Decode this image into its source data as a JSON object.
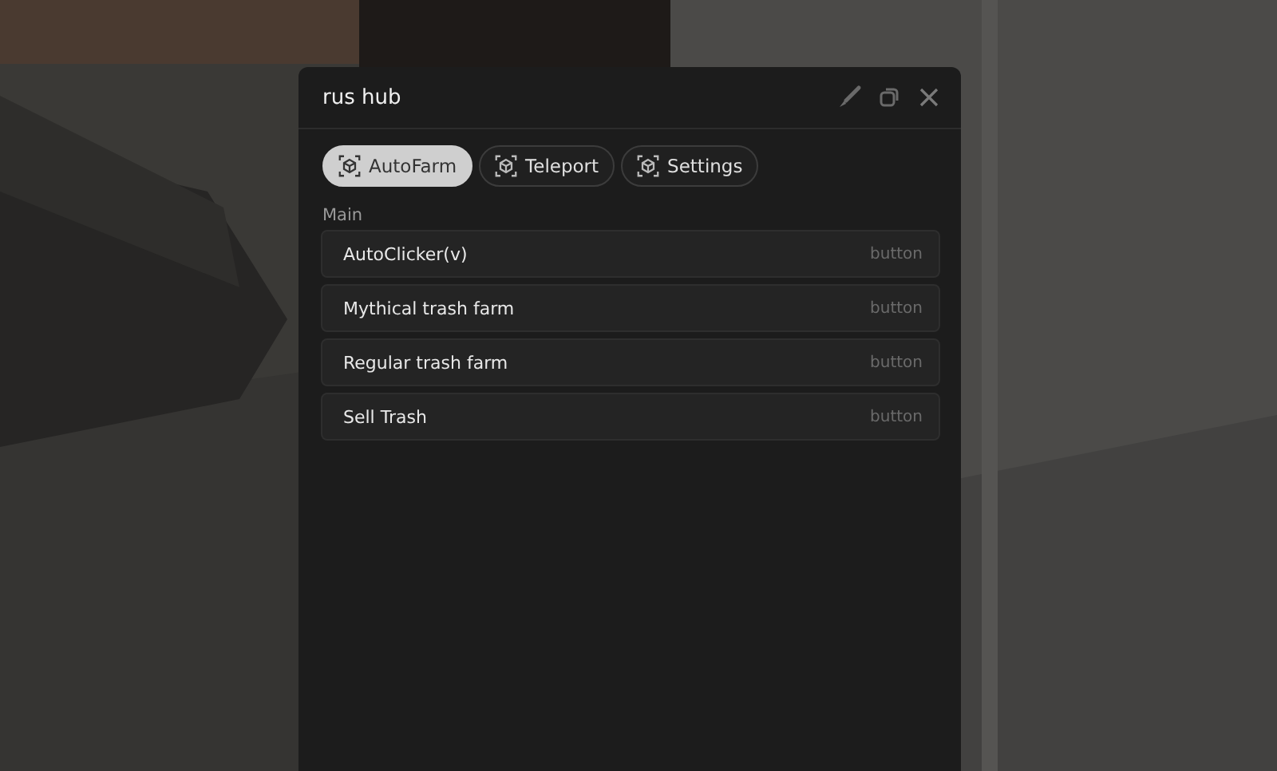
{
  "window": {
    "title": "rus hub"
  },
  "tabs": [
    {
      "label": "AutoFarm",
      "selected": true
    },
    {
      "label": "Teleport",
      "selected": false
    },
    {
      "label": "Settings",
      "selected": false
    }
  ],
  "section": {
    "title": "Main",
    "buttons": [
      {
        "label": "AutoClicker(v)",
        "hint": "button"
      },
      {
        "label": "Mythical trash farm",
        "hint": "button"
      },
      {
        "label": "Regular trash farm",
        "hint": "button"
      },
      {
        "label": "Sell Trash",
        "hint": "button"
      }
    ]
  }
}
